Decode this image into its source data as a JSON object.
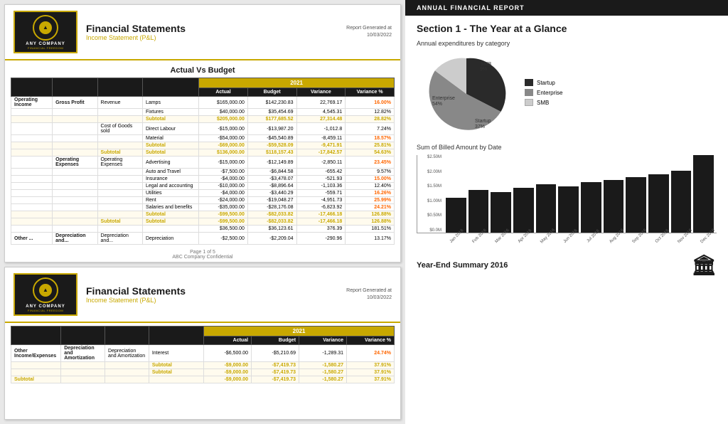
{
  "app": {
    "company_name": "ANY COMPANY",
    "company_tagline": "FINANCIAL FREEDOM",
    "report_title": "Financial Statements",
    "report_subtitle": "Income Statement (P&L)",
    "report_generated_label": "Report Generated at",
    "report_date": "10/03/2022",
    "confidential": "ABC Company Confidential",
    "page_label": "Page 1 of 5"
  },
  "table1": {
    "title": "Actual Vs Budget",
    "year_header": "2021",
    "col_actual": "Actual",
    "col_budget": "Budget",
    "col_variance": "Variance",
    "col_variance_pct": "Variance %",
    "rows": [
      {
        "cat": "Operating Income",
        "type": "Gross Profit",
        "item_type": "Revenue",
        "item": "Lamps",
        "actual": "$165,000.00",
        "budget": "$142,230.83",
        "variance": "22,769.17",
        "vpct": "16.00%",
        "vpct_class": "variance-orange"
      },
      {
        "cat": "",
        "type": "",
        "item_type": "",
        "item": "Fixtures",
        "actual": "$40,000.00",
        "budget": "$35,454.69",
        "variance": "4,545.31",
        "vpct": "12.82%",
        "vpct_class": ""
      },
      {
        "cat": "",
        "type": "",
        "item_type": "subtotal",
        "item": "Subtotal",
        "actual": "$205,000.00",
        "budget": "$177,685.52",
        "variance": "27,314.48",
        "vpct": "28.82%",
        "vpct_class": "",
        "is_subtotal": true
      },
      {
        "cat": "",
        "type": "",
        "item_type": "Cost of Goods sold",
        "item": "Direct Labour",
        "actual": "-$15,000.00",
        "budget": "-$13,987.20",
        "variance": "-1,012.8",
        "vpct": "7.24%",
        "vpct_class": ""
      },
      {
        "cat": "",
        "type": "",
        "item_type": "",
        "item": "Material",
        "actual": "-$54,000.00",
        "budget": "-$45,540.89",
        "variance": "-8,459.11",
        "vpct": "18.57%",
        "vpct_class": "variance-orange"
      },
      {
        "cat": "",
        "type": "",
        "item_type": "subtotal",
        "item": "Subtotal",
        "actual": "-$69,000.00",
        "budget": "-$59,528.09",
        "variance": "-9,471.91",
        "vpct": "25.81%",
        "vpct_class": "",
        "is_subtotal": true
      },
      {
        "cat": "",
        "type": "subtotal_row",
        "item_type": "Subtotal",
        "item": "",
        "actual": "$136,000.00",
        "budget": "$118,157.43",
        "variance": "-17,842.57",
        "vpct": "54.63%",
        "vpct_class": "",
        "is_subtotal": true
      },
      {
        "cat": "",
        "type": "Operating Expenses",
        "item_type": "Operating Expenses",
        "item": "Advertising",
        "actual": "-$15,000.00",
        "budget": "-$12,149.89",
        "variance": "-2,850.11",
        "vpct": "23.45%",
        "vpct_class": "variance-orange"
      },
      {
        "cat": "",
        "type": "",
        "item_type": "",
        "item": "Auto and Travel",
        "actual": "-$7,500.00",
        "budget": "-$6,844.58",
        "variance": "-655.42",
        "vpct": "9.57%",
        "vpct_class": ""
      },
      {
        "cat": "",
        "type": "",
        "item_type": "",
        "item": "Insurance",
        "actual": "-$4,000.00",
        "budget": "-$3,478.07",
        "variance": "-521.93",
        "vpct": "15.00%",
        "vpct_class": "variance-orange"
      },
      {
        "cat": "",
        "type": "",
        "item_type": "",
        "item": "Legal and accounting",
        "actual": "-$10,000.00",
        "budget": "-$8,896.64",
        "variance": "-1,103.36",
        "vpct": "12.40%",
        "vpct_class": ""
      },
      {
        "cat": "",
        "type": "",
        "item_type": "",
        "item": "Utilities",
        "actual": "-$4,000.00",
        "budget": "-$3,440.29",
        "variance": "-559.71",
        "vpct": "16.26%",
        "vpct_class": "variance-orange"
      },
      {
        "cat": "",
        "type": "",
        "item_type": "",
        "item": "Rent",
        "actual": "-$24,000.00",
        "budget": "-$19,048.27",
        "variance": "-4,951.73",
        "vpct": "25.99%",
        "vpct_class": "variance-orange"
      },
      {
        "cat": "",
        "type": "",
        "item_type": "",
        "item": "Salaries and benefits",
        "actual": "-$35,000.00",
        "budget": "-$28,176.08",
        "variance": "-6,823.92",
        "vpct": "24.21%",
        "vpct_class": "variance-orange"
      },
      {
        "cat": "",
        "type": "",
        "item_type": "subtotal",
        "item": "Subtotal",
        "actual": "-$99,500.00",
        "budget": "-$82,033.82",
        "variance": "-17,466.18",
        "vpct": "126.88%",
        "vpct_class": "",
        "is_subtotal": true
      },
      {
        "cat": "",
        "type": "subtotal_row2",
        "item_type": "Subtotal",
        "item": "",
        "actual": "-$99,500.00",
        "budget": "-$82,033.82",
        "variance": "-17,466.18",
        "vpct": "126.88%",
        "vpct_class": "",
        "is_subtotal": true
      },
      {
        "cat": "",
        "type": "",
        "item_type": "",
        "item": "",
        "actual": "$36,500.00",
        "budget": "$36,123.61",
        "variance": "376.39",
        "vpct": "181.51%",
        "vpct_class": ""
      },
      {
        "cat": "Other ...",
        "type": "Depreciation and...",
        "item_type": "Depreciation and...",
        "item": "Depreciation",
        "actual": "-$2,500.00",
        "budget": "-$2,209.04",
        "variance": "-290.96",
        "vpct": "13.17%",
        "vpct_class": ""
      }
    ]
  },
  "table2": {
    "year_header": "2021",
    "col_actual": "Actual",
    "col_budget": "Budget",
    "col_variance": "Variance",
    "col_variance_pct": "Variance %",
    "rows": [
      {
        "cat": "Other Income/Expenses",
        "type": "Depreciation and Amortization",
        "item_type": "Depreciation and Amortization",
        "item": "Interest",
        "actual": "-$6,500.00",
        "budget": "-$5,210.69",
        "variance": "-1,289.31",
        "vpct": "24.74%",
        "vpct_class": "variance-orange"
      },
      {
        "cat": "",
        "type": "",
        "item_type": "subtotal",
        "item": "Subtotal",
        "actual": "-$9,000.00",
        "budget": "-$7,419.73",
        "variance": "-1,580.27",
        "vpct": "37.91%",
        "vpct_class": "",
        "is_subtotal": true
      },
      {
        "cat": "",
        "type": "",
        "item_type": "subtotal2",
        "item": "Subtotal",
        "actual": "-$9,000.00",
        "budget": "-$7,419.73",
        "variance": "-1,580.27",
        "vpct": "37.91%",
        "vpct_class": "",
        "is_subtotal": true
      },
      {
        "cat": "Subtotal",
        "type": "",
        "item_type": "",
        "item": "",
        "actual": "-$9,000.00",
        "budget": "-$7,419.73",
        "variance": "-1,580.27",
        "vpct": "37.91%",
        "vpct_class": "",
        "is_subtotal": true
      }
    ]
  },
  "right_panel": {
    "top_bar_text": "ANNUAL FINANCIAL REPORT",
    "section_title": "Section 1 - The Year at a Glance",
    "pie_title": "Annual expenditures by category",
    "pie_segments": [
      {
        "label": "Startup",
        "pct": 37,
        "color": "#2a2a2a",
        "display": "37%"
      },
      {
        "label": "Enterprise",
        "pct": 54,
        "color": "#888888",
        "display": "54%"
      },
      {
        "label": "SMB",
        "pct": 9,
        "color": "#cccccc",
        "display": "9%"
      }
    ],
    "pie_annotations": [
      {
        "label": "SMB 9%",
        "position": "top-right"
      },
      {
        "label": "Enterprise 54%",
        "position": "left"
      },
      {
        "label": "Startup 37%",
        "position": "bottom-right"
      }
    ],
    "bar_chart_title": "Sum of Billed Amount by Date",
    "bar_y_labels": [
      "$2.50M",
      "$2.00M",
      "$1.50M",
      "$1.00M",
      "$0.50M",
      "$0.0M"
    ],
    "bar_x_labels": [
      "Jan 2016",
      "Feb 2016",
      "Mar 2016",
      "Apr 2016",
      "May 2016",
      "Jun 2016",
      "Jul 2016",
      "Aug 2016",
      "Sep 2016",
      "Oct 2016",
      "Nov 2016",
      "Dec 2016"
    ],
    "bar_values": [
      45,
      55,
      52,
      58,
      62,
      60,
      65,
      68,
      72,
      75,
      80,
      100
    ],
    "year_end_title": "Year-End Summary 2016"
  }
}
